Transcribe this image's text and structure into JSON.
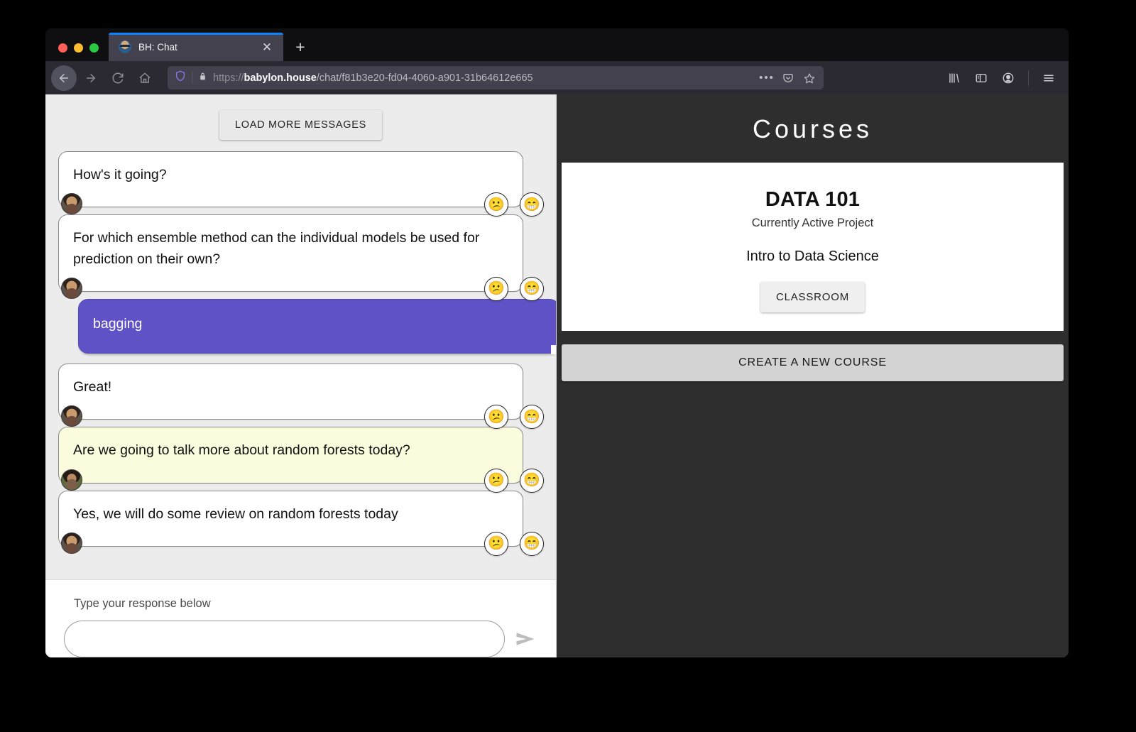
{
  "browser": {
    "tab": {
      "title": "BH: Chat",
      "favicon": "avatar-favicon",
      "close_label": "✕",
      "new_tab_label": "+"
    },
    "nav": {
      "back_label": "back-arrow",
      "forward_label": "forward-arrow",
      "reload_label": "reload",
      "home_label": "home"
    },
    "url": {
      "scheme": "https://",
      "domain": "babylon.house",
      "path": "/chat/f81b3e20-fd04-4060-a901-31b64612e665",
      "full": "https://babylon.house/chat/f81b3e20-fd04-4060-a901-31b64612e665",
      "shield_icon": "shield-icon",
      "lock_icon": "padlock-icon",
      "page_actions_icon": "ellipsis-icon",
      "pocket_icon": "pocket-icon",
      "bookmark_icon": "star-icon"
    },
    "toolbar_right": {
      "library_icon": "library-icon",
      "sidebar_icon": "sidebar-icon",
      "account_icon": "account-icon",
      "menu_icon": "hamburger-menu-icon"
    }
  },
  "chat": {
    "load_more_label": "LOAD MORE MESSAGES",
    "messages": [
      {
        "text": "How's it going?",
        "author": "instructor",
        "style": "plain",
        "reactions": [
          "😕",
          "😁"
        ]
      },
      {
        "text": "For which ensemble method can the individual models be used for prediction on their own?",
        "author": "instructor",
        "style": "plain",
        "reactions": [
          "😕",
          "😁"
        ]
      },
      {
        "text": "bagging",
        "author": "self",
        "style": "own",
        "reactions": []
      },
      {
        "text": "Great!",
        "author": "instructor",
        "style": "plain",
        "reactions": [
          "😕",
          "😁"
        ]
      },
      {
        "text": "Are we going to talk more about random forests today?",
        "author": "student",
        "style": "highlight",
        "reactions": [
          "😕",
          "😁"
        ]
      },
      {
        "text": "Yes, we will do some review on random forests today",
        "author": "instructor",
        "style": "plain",
        "reactions": [
          "😕",
          "😁"
        ]
      }
    ],
    "composer": {
      "label": "Type your response below",
      "value": "",
      "placeholder": "",
      "send_icon": "send-arrow-icon"
    }
  },
  "courses": {
    "title": "Courses",
    "active_course": {
      "code": "DATA 101",
      "status": "Currently Active Project",
      "name": "Intro to Data Science",
      "classroom_label": "CLASSROOM"
    },
    "create_label": "CREATE A NEW COURSE"
  },
  "colors": {
    "own_bubble": "#5f51c6",
    "highlight_bubble": "#fbfbdd",
    "panel_dark": "#2e2e2e",
    "chat_bg": "#ececec",
    "tab_accent": "#0a84ff"
  }
}
